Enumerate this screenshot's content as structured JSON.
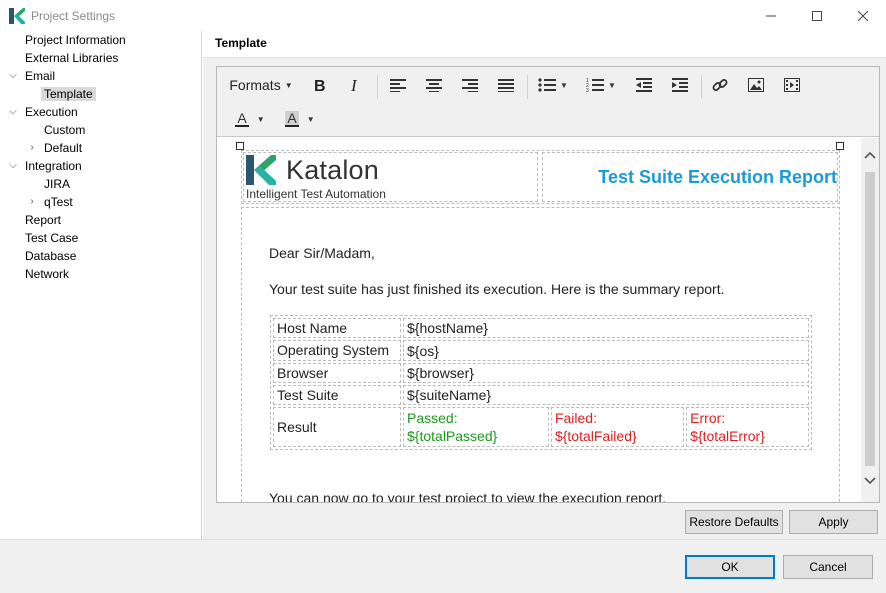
{
  "window": {
    "title": "Project Settings",
    "controls": [
      "minimize-icon",
      "maximize-icon",
      "close-icon"
    ]
  },
  "sidebar": {
    "items": [
      {
        "label": "Project Information"
      },
      {
        "label": "External Libraries"
      },
      {
        "label": "Email",
        "expanded": true
      },
      {
        "label": "Template",
        "selected": true
      },
      {
        "label": "Execution",
        "expanded": true
      },
      {
        "label": "Custom"
      },
      {
        "label": "Default",
        "expandable": true
      },
      {
        "label": "Integration",
        "expanded": true
      },
      {
        "label": "JIRA"
      },
      {
        "label": "qTest",
        "expandable": true
      },
      {
        "label": "Report"
      },
      {
        "label": "Test Case"
      },
      {
        "label": "Database"
      },
      {
        "label": "Network"
      }
    ]
  },
  "main": {
    "header": "Template"
  },
  "toolbar": {
    "formats_label": "Formats",
    "buttons": [
      "bold-icon",
      "italic-icon",
      "align-left-icon",
      "align-center-icon",
      "align-right-icon",
      "align-justify-icon",
      "bullet-list-icon",
      "numbered-list-icon",
      "outdent-icon",
      "indent-icon",
      "link-icon",
      "image-icon",
      "media-icon",
      "text-color-icon",
      "background-color-icon"
    ],
    "text_color_glyph": "A",
    "bg_color_glyph": "A"
  },
  "document": {
    "brand_name": "Katalon",
    "brand_tagline": "Intelligent Test Automation",
    "report_title": "Test Suite Execution Report",
    "greeting": "Dear Sir/Madam,",
    "intro": "Your test suite has just finished its execution. Here is the summary report.",
    "rows": [
      {
        "key": "Host Name",
        "value": "${hostName}"
      },
      {
        "key": "Operating System",
        "value": "${os}"
      },
      {
        "key": "Browser",
        "value": "${browser}"
      },
      {
        "key": "Test Suite",
        "value": "${suiteName}"
      }
    ],
    "result": {
      "key": "Result",
      "passed_label": "Passed:",
      "passed_value": "${totalPassed}",
      "failed_label": "Failed:",
      "failed_value": "${totalFailed}",
      "error_label": "Error:",
      "error_value": "${totalError}"
    },
    "outro": "You can now go to your test project to view the execution report."
  },
  "buttons": {
    "restore_defaults": "Restore Defaults",
    "apply": "Apply",
    "ok": "OK",
    "cancel": "Cancel"
  },
  "colors": {
    "accent": "#1c9ad6",
    "passed": "#1a9a1a",
    "failed": "#e01e1e",
    "primary_border": "#0078d7"
  }
}
